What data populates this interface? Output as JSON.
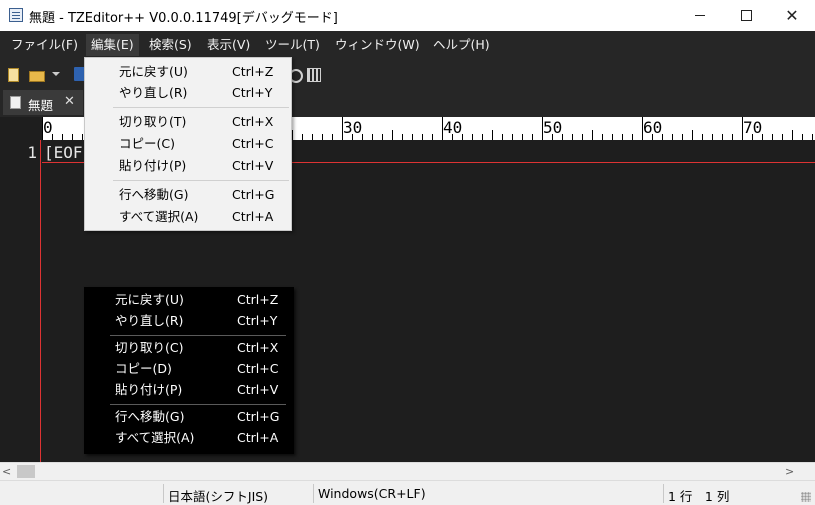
{
  "window": {
    "title": "無題 - TZEditor++ V0.0.0.11749[デバッグモード]",
    "close_glyph": "✕"
  },
  "menubar": {
    "items": [
      "ファイル(F)",
      "編集(E)",
      "検索(S)",
      "表示(V)",
      "ツール(T)",
      "ウィンドウ(W)",
      "ヘルプ(H)"
    ],
    "active": "編集(E)"
  },
  "tab": {
    "label": "無題",
    "close_glyph": "✕"
  },
  "ruler": {
    "labels": [
      "0",
      "30",
      "40",
      "50",
      "60",
      "70"
    ]
  },
  "editor": {
    "line_number": "1",
    "eof_marker": "[EOF"
  },
  "edit_menu": {
    "items": [
      {
        "label": "元に戻す(U)",
        "shortcut": "Ctrl+Z"
      },
      {
        "label": "やり直し(R)",
        "shortcut": "Ctrl+Y"
      },
      {
        "label": "切り取り(T)",
        "shortcut": "Ctrl+X"
      },
      {
        "label": "コピー(C)",
        "shortcut": "Ctrl+C"
      },
      {
        "label": "貼り付け(P)",
        "shortcut": "Ctrl+V"
      },
      {
        "label": "行へ移動(G)",
        "shortcut": "Ctrl+G"
      },
      {
        "label": "すべて選択(A)",
        "shortcut": "Ctrl+A"
      }
    ]
  },
  "context_menu": {
    "items": [
      {
        "label": "元に戻す(U)",
        "shortcut": "Ctrl+Z"
      },
      {
        "label": "やり直し(R)",
        "shortcut": "Ctrl+Y"
      },
      {
        "label": "切り取り(C)",
        "shortcut": "Ctrl+X"
      },
      {
        "label": "コピー(D)",
        "shortcut": "Ctrl+C"
      },
      {
        "label": "貼り付け(P)",
        "shortcut": "Ctrl+V"
      },
      {
        "label": "行へ移動(G)",
        "shortcut": "Ctrl+G"
      },
      {
        "label": "すべて選択(A)",
        "shortcut": "Ctrl+A"
      }
    ]
  },
  "scrollbar": {
    "left_arrow": "<",
    "right_arrow": ">"
  },
  "statusbar": {
    "encoding": "日本語(シフトJIS)",
    "line_ending": "Windows(CR+LF)",
    "position": "1 行　1 列"
  },
  "icons": [
    "new-file-icon",
    "open-folder-icon",
    "save-icon",
    "find-icon",
    "grid-icon",
    "document-icon"
  ]
}
